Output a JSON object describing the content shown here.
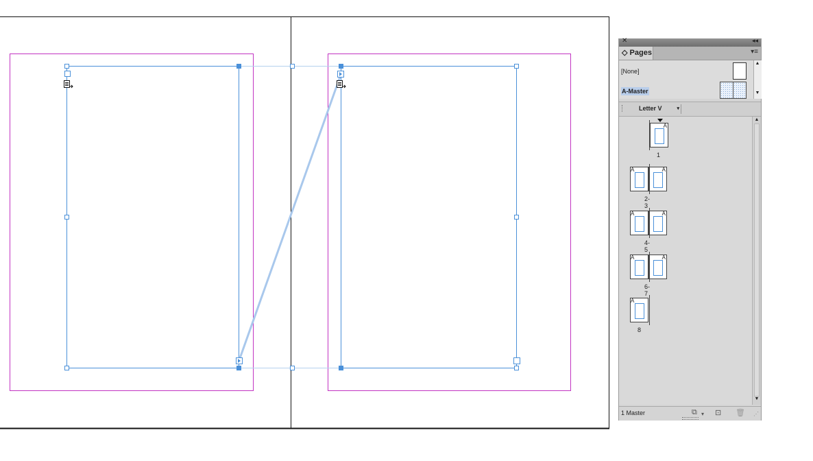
{
  "panel": {
    "title": "Pages",
    "close_glyph": "✕",
    "collapse_glyph": "◂◂",
    "menu_glyph": "▾≡",
    "masters": [
      {
        "label": "[None]"
      },
      {
        "label": "A-Master"
      }
    ],
    "page_size": "Letter V",
    "page_size_arrow": "▾",
    "spreads": [
      {
        "label": "1",
        "pages": [
          {
            "master": "A"
          }
        ]
      },
      {
        "label": "2-3",
        "pages": [
          {
            "master": "A"
          },
          {
            "master": "A"
          }
        ]
      },
      {
        "label": "4-5",
        "pages": [
          {
            "master": "A"
          },
          {
            "master": "A"
          }
        ]
      },
      {
        "label": "6-7",
        "pages": [
          {
            "master": "A"
          },
          {
            "master": "A"
          }
        ]
      },
      {
        "label": "8",
        "pages": [
          {
            "master": "A"
          }
        ]
      }
    ],
    "footer_text": "1 Master",
    "icons": [
      "edit-page-size-icon",
      "new-page-icon",
      "delete-page-icon"
    ]
  },
  "colors": {
    "margin": "#c233c2",
    "frame": "#4a90d9",
    "thread": "#a9c8ec",
    "highlight": "#b8cdea"
  }
}
